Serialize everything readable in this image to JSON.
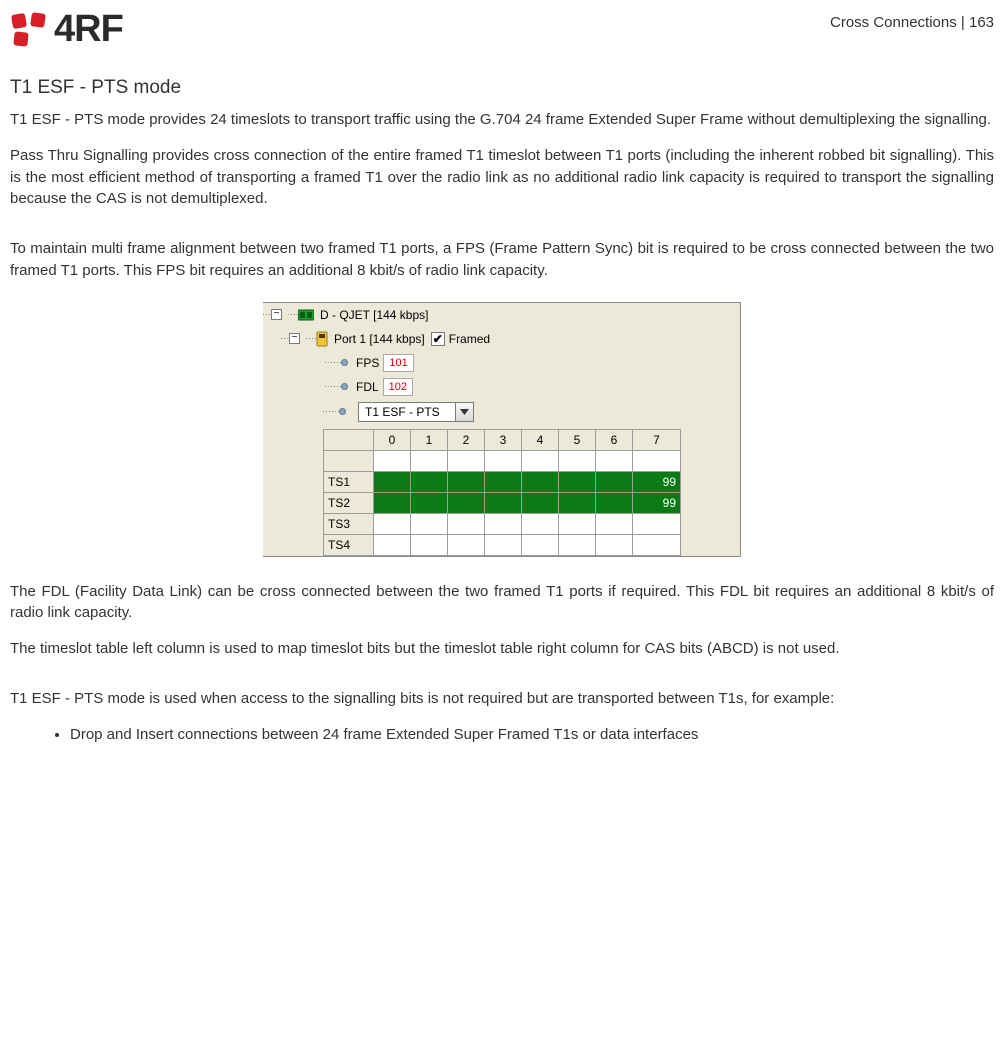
{
  "header": {
    "brand": "4RF",
    "breadcrumb": "Cross Connections  |  163"
  },
  "title": "T1 ESF - PTS mode",
  "paragraphs": {
    "p1": "T1 ESF - PTS mode provides 24 timeslots to transport traffic using the G.704 24 frame Extended Super Frame without demultiplexing the signalling.",
    "p2": "Pass Thru Signalling provides cross connection of the entire framed T1 timeslot between T1 ports (including the inherent robbed bit signalling). This is the most efficient method of transporting a framed T1 over the radio link as no additional radio link capacity is required to transport the signalling because the CAS is not demultiplexed.",
    "p3": "To maintain multi frame alignment between two framed T1 ports, a FPS (Frame Pattern Sync) bit is required to be cross connected between the two framed T1 ports. This FPS bit requires an additional 8 kbit/s of radio link capacity.",
    "p4": "The FDL (Facility Data Link) can be cross connected between the two framed T1 ports if required. This FDL bit requires an additional 8 kbit/s of radio link capacity.",
    "p5": "The timeslot table left column is used to map timeslot bits but the timeslot table right column for CAS bits (ABCD) is not used.",
    "p6": "T1 ESF - PTS mode is used when access to the signalling bits is not required but are transported between T1s, for example:"
  },
  "bullets": {
    "b1": "Drop and Insert connections between 24 frame Extended Super Framed T1s or data interfaces"
  },
  "figure": {
    "device_label": "D - QJET [144 kbps]",
    "port_label": "Port 1 [144 kbps]",
    "framed_label": "Framed",
    "framed_checked": "✔",
    "fps_label": "FPS",
    "fps_tag": "101",
    "fdl_label": "FDL",
    "fdl_tag": "102",
    "mode_value": "T1 ESF - PTS",
    "table": {
      "cols": [
        "",
        "0",
        "1",
        "2",
        "3",
        "4",
        "5",
        "6",
        "7"
      ],
      "rows": [
        {
          "label": "",
          "cells": [
            "",
            "",
            "",
            "",
            "",
            "",
            "",
            ""
          ]
        },
        {
          "label": "TS1",
          "cells": [
            "g",
            "g",
            "g",
            "g",
            "g",
            "g",
            "g",
            "99"
          ]
        },
        {
          "label": "TS2",
          "cells": [
            "g",
            "g",
            "g",
            "g",
            "g",
            "g",
            "g",
            "99"
          ]
        },
        {
          "label": "TS3",
          "cells": [
            "",
            "",
            "",
            "",
            "",
            "",
            "",
            ""
          ]
        },
        {
          "label": "TS4",
          "cells": [
            "",
            "",
            "",
            "",
            "",
            "",
            "",
            ""
          ]
        }
      ]
    },
    "expander": "−"
  }
}
